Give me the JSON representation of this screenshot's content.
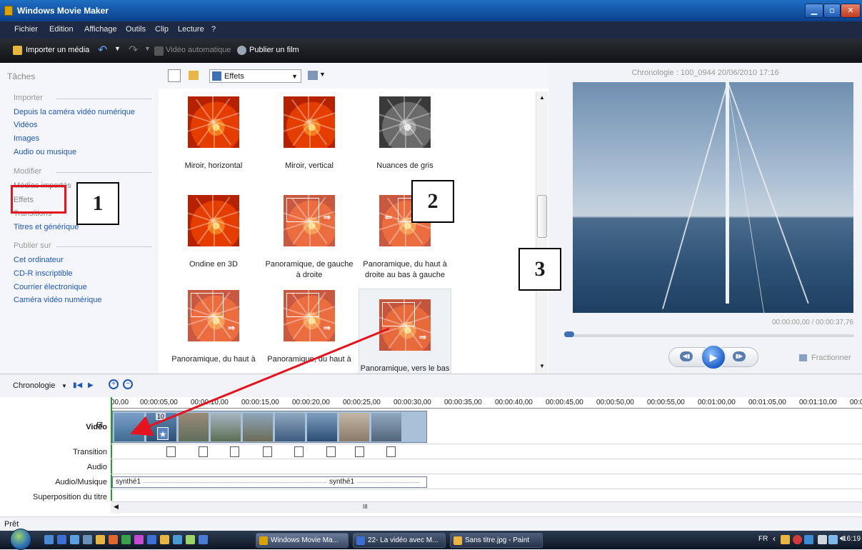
{
  "window": {
    "title": "Windows Movie Maker"
  },
  "menu": [
    "Fichier",
    "Edition",
    "Affichage",
    "Outils",
    "Clip",
    "Lecture",
    "?"
  ],
  "toolbar": {
    "import": "Importer un média",
    "auto": "Vidéo automatique",
    "publish": "Publier un film"
  },
  "tasks": {
    "header": "Tâches",
    "import_section": "Importer",
    "import_items": [
      "Depuis la caméra vidéo numérique",
      "Vidéos",
      "Images",
      "Audio ou musique"
    ],
    "modify_section": "Modifier",
    "modify_items": [
      "Médias importés",
      "Effets",
      "Transitions",
      "Titres et générique"
    ],
    "publish_section": "Publier sur",
    "publish_items": [
      "Cet ordinateur",
      "CD-R inscriptible",
      "Courrier électronique",
      "Caméra vidéo numérique"
    ]
  },
  "effects": {
    "dropdown": "Effets",
    "tiles": [
      {
        "label": "Miroir, horizontal",
        "style": "plain"
      },
      {
        "label": "Miroir, vertical",
        "style": "plain"
      },
      {
        "label": "Nuances de gris",
        "style": "gray"
      },
      {
        "label": "Ondine en 3D",
        "style": "plain"
      },
      {
        "label": "Panoramique, de gauche à droite",
        "style": "pan"
      },
      {
        "label": "Panoramique, du haut à droite au bas à gauche",
        "style": "pan"
      },
      {
        "label": "Panoramique, du haut à",
        "style": "pan"
      },
      {
        "label": "Panoramique, du haut à",
        "style": "pan"
      },
      {
        "label": "Panoramique, vers le bas et",
        "style": "pan"
      }
    ]
  },
  "preview": {
    "title": "Chronologie : 100_0944 20/06/2010 17:16",
    "timecode": "00:00:00,00 / 00:00:37,76",
    "split": "Fractionner",
    "progress": 0
  },
  "timeline": {
    "label": "Chronologie",
    "ticks": [
      "00,00",
      "00:00:05,00",
      "00:00:10,00",
      "00:00:15,00",
      "00:00:20,00",
      "00:00:25,00",
      "00:00:30,00",
      "00:00:35,00",
      "00:00:40,00",
      "00:00:45,00",
      "00:00:50,00",
      "00:00:55,00",
      "00:01:00,00",
      "00:01:05,00",
      "00:01:10,00",
      "00:0"
    ],
    "tracks": [
      "Vidéo",
      "Transition",
      "Audio",
      "Audio/Musique",
      "Superposition du titre"
    ],
    "clip_first_label": "10",
    "audio_label": "synthé1",
    "audio_label_2": "synthé1",
    "hscroll_grip": "III"
  },
  "status": "Prêt",
  "taskbar": {
    "buttons": [
      "Windows Movie Ma...",
      "22- La vidéo avec M...",
      "Sans titre.jpg - Paint"
    ],
    "lang": "FR",
    "time": "16:19"
  },
  "annotations": {
    "n1": "1",
    "n2": "2",
    "n3": "3"
  },
  "colors": {
    "accent": "#1e56b3",
    "annotation_red": "#e3141e",
    "timeline_cursor": "#2a9a2a"
  }
}
